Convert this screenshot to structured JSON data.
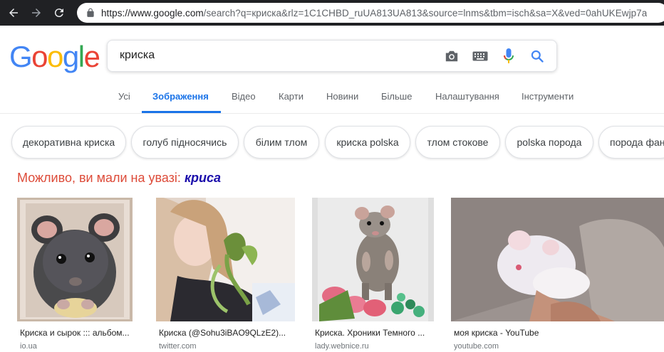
{
  "browser": {
    "url_host": "https://www.google.com",
    "url_rest": "/search?q=криска&rlz=1C1CHBD_ruUA813UA813&source=lnms&tbm=isch&sa=X&ved=0ahUKEwjp7a"
  },
  "logo": [
    "G",
    "o",
    "o",
    "g",
    "l",
    "e"
  ],
  "search": {
    "query": "криска"
  },
  "tabs": [
    {
      "label": "Усі"
    },
    {
      "label": "Зображення",
      "active": true
    },
    {
      "label": "Відео"
    },
    {
      "label": "Карти"
    },
    {
      "label": "Новини"
    },
    {
      "label": "Більше"
    },
    {
      "label": "Налаштування"
    },
    {
      "label": "Інструменти"
    }
  ],
  "chips": [
    "декоративна криска",
    "голуб підносячись",
    "білим тлом",
    "криска polska",
    "тлом стокове",
    "polska порода",
    "порода фан"
  ],
  "did_you_mean": {
    "prefix": "Можливо, ви мали на увазі:",
    "suggestion": "криса"
  },
  "results": [
    {
      "title": "Криска и сырок ::: альбом...",
      "source": "io.ua"
    },
    {
      "title": "Криска (@Sohu3iBAO9QLzE2)...",
      "source": "twitter.com"
    },
    {
      "title": "Криска. Хроники Темного ...",
      "source": "lady.webnice.ru"
    },
    {
      "title": "моя криска - YouTube",
      "source": "youtube.com"
    }
  ],
  "colors": {
    "accent": "#1a73e8",
    "dym_red": "#dd4b39",
    "link": "#1a0dab"
  }
}
